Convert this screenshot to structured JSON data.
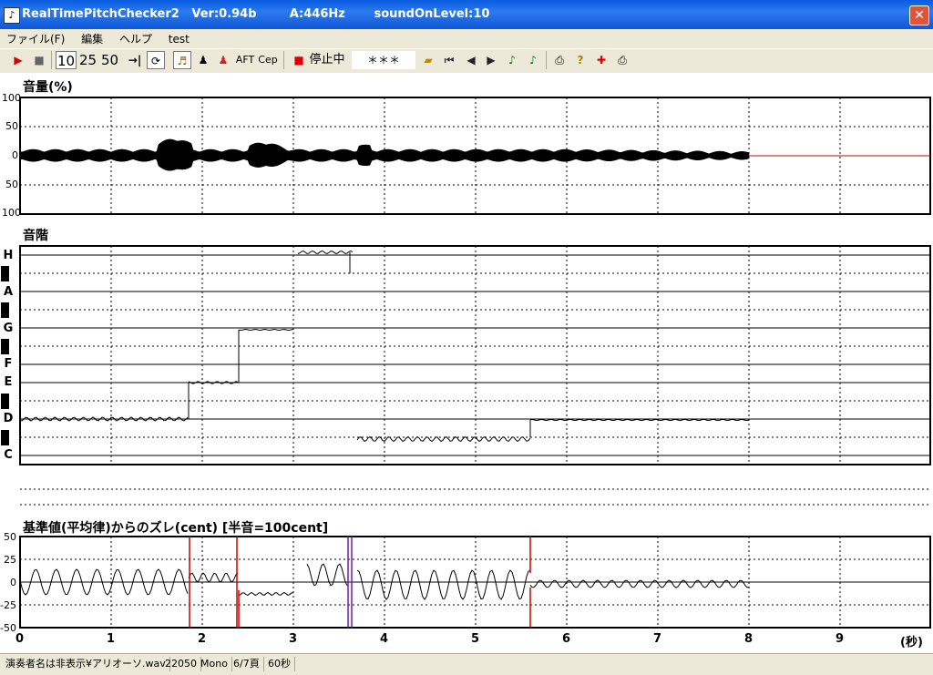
{
  "window": {
    "title": "RealTimePitchChecker2   Ver:0.94b        A:446Hz       soundOnLevel:10",
    "close_glyph": "✕"
  },
  "menu": [
    "ファイル(F)",
    "編集",
    "ヘルプ",
    "test"
  ],
  "toolbar": {
    "n10": "10",
    "n25": "25",
    "n50": "50",
    "aft": "AFT",
    "cep": "Cep",
    "stop_label": "停止中",
    "pitch_display": "＊＊＊"
  },
  "volume_panel": {
    "title": "音量(%)",
    "y_ticks": [
      "100",
      "50",
      "0",
      "50",
      "100"
    ]
  },
  "pitch_panel": {
    "title": "音階",
    "notes": [
      "H",
      "A",
      "G",
      "F",
      "E",
      "D",
      "C"
    ]
  },
  "cent_panel": {
    "title": "基準値(平均律)からのズレ(cent) [半音=100cent]",
    "y_ticks": [
      "50",
      "25",
      "0",
      "-25",
      "-50"
    ]
  },
  "x_axis": {
    "ticks": [
      "0",
      "1",
      "2",
      "3",
      "4",
      "5",
      "6",
      "7",
      "8",
      "9"
    ],
    "unit": "(秒)"
  },
  "colors": {
    "waveform": "#000000",
    "flatline": "#d00000",
    "marker_red": "#cc0000",
    "marker_purple": "#6b1fa8"
  },
  "status": {
    "file": "演奏者名は非表示¥アリオーソ.wav",
    "rate": "22050",
    "channels": "Mono",
    "page": "6/7頁",
    "length": "60秒"
  }
}
